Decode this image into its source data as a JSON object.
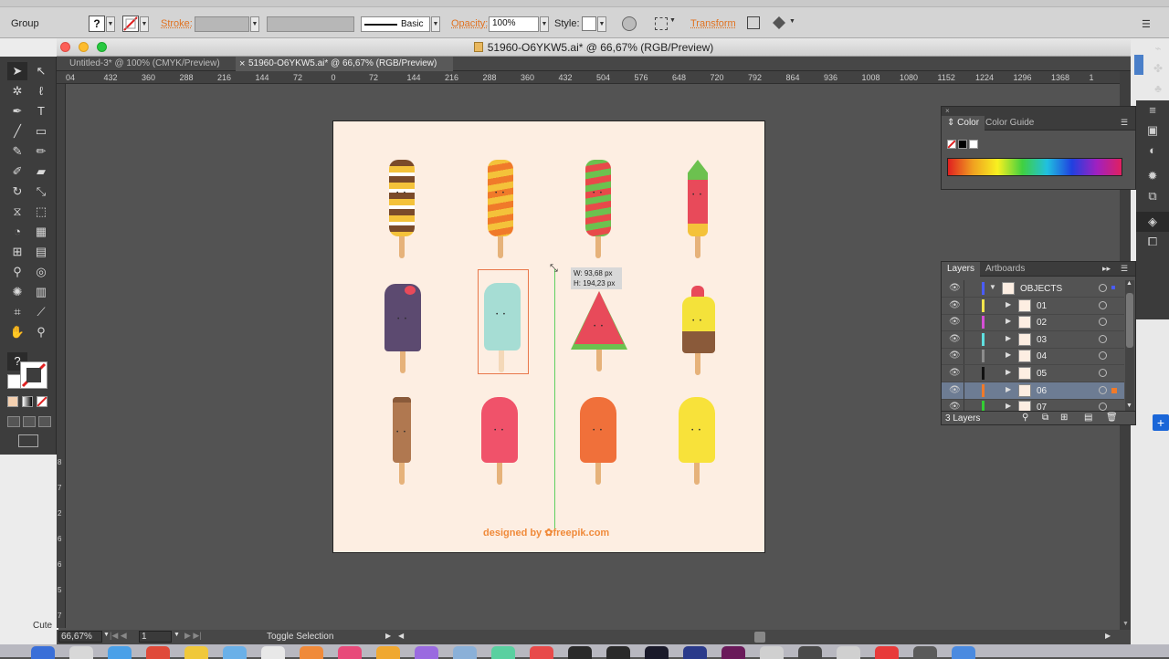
{
  "control_bar": {
    "selection_type": "Group",
    "stroke_label": "Stroke:",
    "brush_label": "Basic",
    "opacity_label": "Opacity:",
    "opacity_value": "100%",
    "style_label": "Style:",
    "transform_label": "Transform",
    "unknown_fill": "?"
  },
  "window": {
    "title": "51960-O6YKW5.ai* @ 66,67% (RGB/Preview)",
    "tabs": [
      {
        "label": "Untitled-3* @ 100% (CMYK/Preview)",
        "active": false
      },
      {
        "label": "51960-O6YKW5.ai* @ 66,67% (RGB/Preview)",
        "active": true
      }
    ]
  },
  "rulers": {
    "horizontal": [
      "04",
      "432",
      "360",
      "288",
      "216",
      "144",
      "72",
      "0",
      "72",
      "144",
      "216",
      "288",
      "360",
      "432",
      "504",
      "576",
      "648",
      "720",
      "792",
      "864",
      "936",
      "1008",
      "1080",
      "1152",
      "1224",
      "1296",
      "1368",
      "1"
    ],
    "vertical": [
      "8",
      "7",
      "2",
      "6",
      "6",
      "5",
      "7",
      "6"
    ]
  },
  "artboard": {
    "credit_prefix": "designed by",
    "credit_brand": "freepik.com",
    "measure_w": "W: 93,68 px",
    "measure_h": "H: 194,23 px"
  },
  "color_panel": {
    "tabs": [
      "Color",
      "Color Guide"
    ]
  },
  "layers_panel": {
    "tabs": [
      "Layers",
      "Artboards"
    ],
    "layers": [
      {
        "name": "OBJECTS",
        "color": "#4a5cff",
        "expanded": true,
        "selected": false,
        "depth": 0
      },
      {
        "name": "01",
        "color": "#f2e54c",
        "expanded": false,
        "selected": false,
        "depth": 1
      },
      {
        "name": "02",
        "color": "#d64fd6",
        "expanded": false,
        "selected": false,
        "depth": 1
      },
      {
        "name": "03",
        "color": "#5fe0e0",
        "expanded": false,
        "selected": false,
        "depth": 1
      },
      {
        "name": "04",
        "color": "#8c8c8c",
        "expanded": false,
        "selected": false,
        "depth": 1
      },
      {
        "name": "05",
        "color": "#111111",
        "expanded": false,
        "selected": false,
        "depth": 1
      },
      {
        "name": "06",
        "color": "#f07a2a",
        "expanded": false,
        "selected": true,
        "depth": 1
      },
      {
        "name": "07",
        "color": "#33cc33",
        "expanded": false,
        "selected": false,
        "depth": 1
      }
    ],
    "footer": "3 Layers"
  },
  "status_bar": {
    "zoom": "66,67%",
    "page": "1",
    "status_text": "Toggle Selection"
  },
  "behind_window_text": "Cute"
}
